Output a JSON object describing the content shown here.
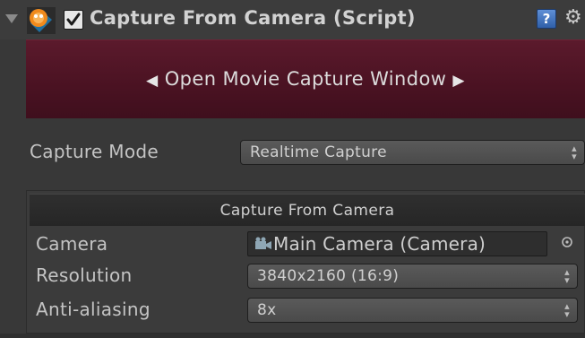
{
  "component": {
    "title": "Capture From Camera (Script)",
    "enabled": true,
    "icon": "movie-capture-icon",
    "help_glyph": "?",
    "gear_glyph": "⚙"
  },
  "movie_button": {
    "label": "Open Movie Capture Window",
    "left_arrow": "◀",
    "right_arrow": "▶"
  },
  "capture_mode": {
    "label": "Capture Mode",
    "value": "Realtime Capture"
  },
  "section": {
    "title": "Capture From Camera"
  },
  "camera": {
    "label": "Camera",
    "value": "Main Camera (Camera)",
    "icon": "camera-icon"
  },
  "resolution": {
    "label": "Resolution",
    "value": "3840x2160 (16:9)"
  },
  "anti_aliasing": {
    "label": "Anti-aliasing",
    "value": "8x"
  },
  "colors": {
    "movie_button": "#4a1222",
    "background": "#383838",
    "icon_orange": "#f08a1c"
  }
}
